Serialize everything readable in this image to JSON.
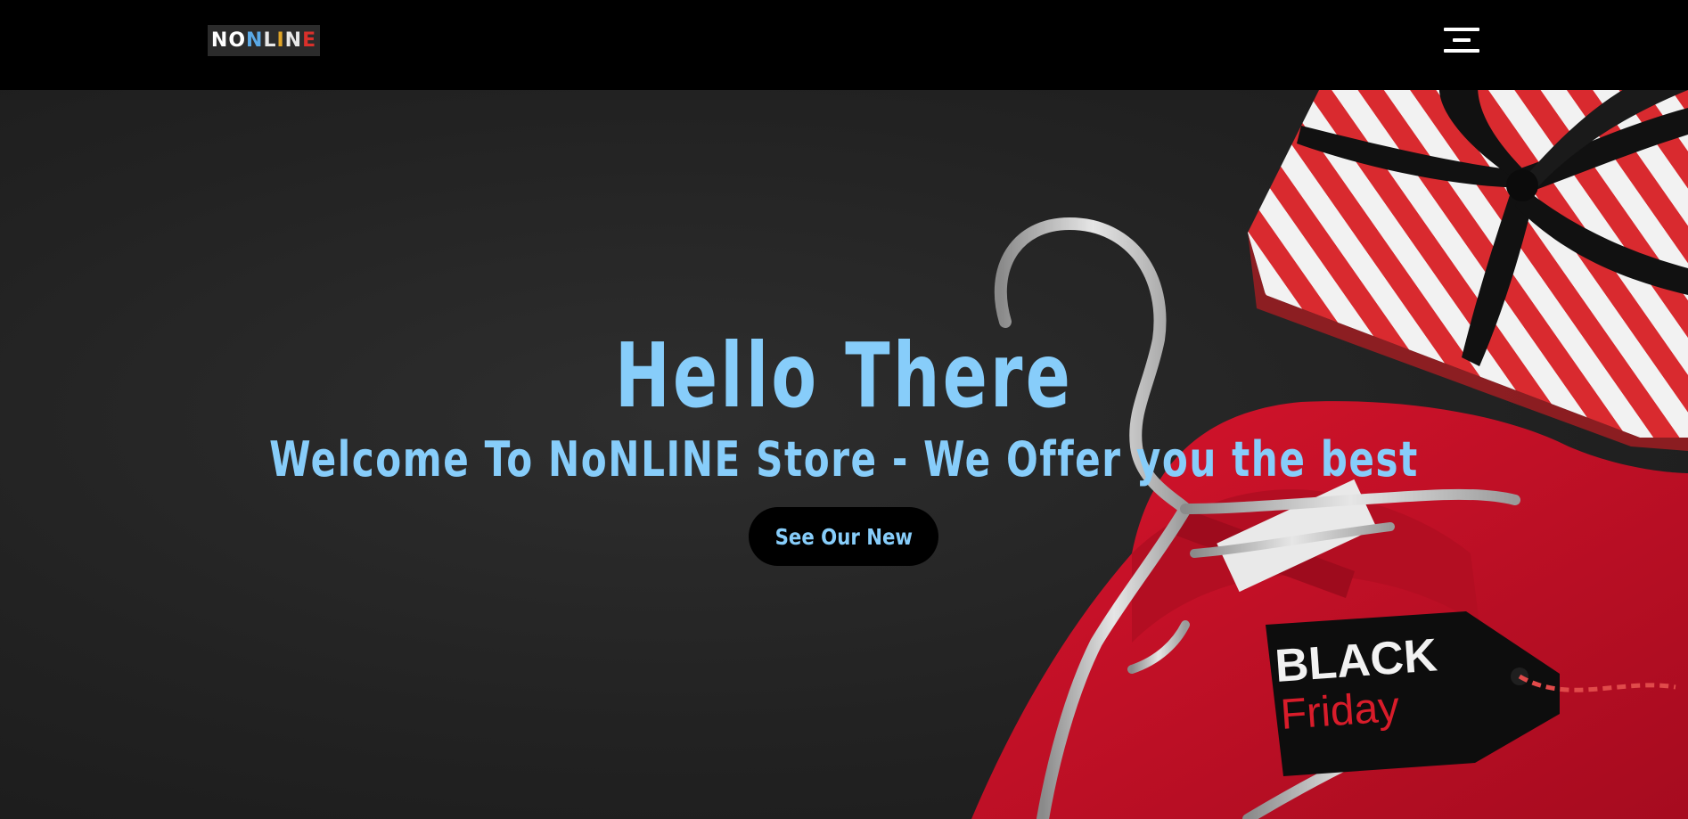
{
  "header": {
    "logo_letters": [
      {
        "char": "N",
        "color": "#ffffff"
      },
      {
        "char": "O",
        "color": "#ffffff"
      },
      {
        "char": "N",
        "color": "#5aa9e6"
      },
      {
        "char": "L",
        "color": "#e8e8e8"
      },
      {
        "char": "I",
        "color": "#e0a528"
      },
      {
        "char": "N",
        "color": "#e8e8e8"
      },
      {
        "char": "E",
        "color": "#d9302b"
      }
    ],
    "menu_icon": "hamburger-menu-icon"
  },
  "hero": {
    "title": "Hello There",
    "subtitle": "Welcome To NoNLINE Store - We Offer you the best",
    "cta_label": "See Our New",
    "tag_line_1": "BLACK",
    "tag_line_2": "Friday",
    "accent_color": "#87cdfa",
    "shirt_color": "#c8102e"
  }
}
